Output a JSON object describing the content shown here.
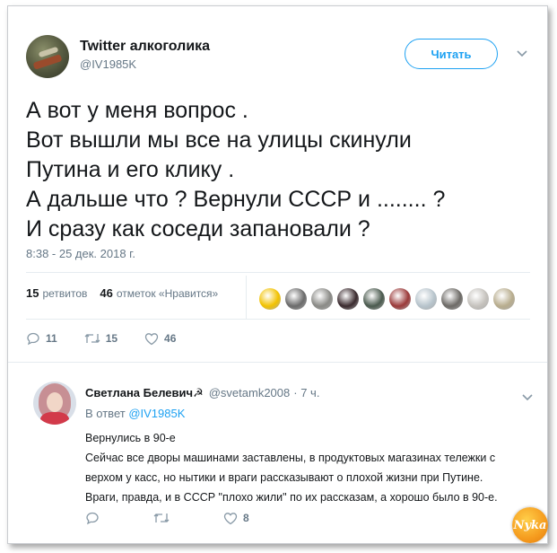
{
  "tweet": {
    "author_name": "Twitter алкоголика",
    "author_handle": "@IV1985K",
    "follow_label": "Читать",
    "text_lines": [
      "А вот у меня вопрос .",
      "Вот вышли мы все на улицы скинули",
      "Путина и его клику .",
      "А дальше что ? Вернули СССР и ........ ?",
      "И сразу как соседи запановали ?"
    ],
    "timestamp": "8:38 - 25 дек. 2018 г.",
    "retweets_count": "15",
    "retweets_label": "ретвитов",
    "likes_count": "46",
    "likes_label": "отметок «Нравится»",
    "actions": {
      "reply_count": "11",
      "retweet_count": "15",
      "like_count": "46"
    }
  },
  "reply": {
    "author_name": "Светлана Белевич☭",
    "author_handle": "@svetamk2008",
    "time": "· 7 ч.",
    "reply_to_prefix": "В ответ",
    "reply_to_handle": "@IV1985K",
    "text_lines": [
      "Вернулись в 90-е",
      "Сейчас все дворы машинами заставлены, в продуктовых магазинах тележки с",
      "верхом у касс, но нытики и враги рассказывают о плохой жизни при Путине.",
      "Враги, правда, и в СССР \"плохо жили\" по их рассказам, а хорошо было в 90-е."
    ],
    "actions": {
      "reply_count": "",
      "retweet_count": "",
      "like_count": "8"
    }
  },
  "watermark_text": "Nyka",
  "colors": {
    "accent": "#1da1f2",
    "text": "#14171a",
    "muted": "#657786",
    "divider": "#e6ecf0"
  },
  "likers": [
    {
      "icon": "liker-avatar-1",
      "color": "#f2c200"
    },
    {
      "icon": "liker-avatar-2",
      "color": "#6b6b6b"
    },
    {
      "icon": "liker-avatar-3",
      "color": "#8a8a86"
    },
    {
      "icon": "liker-avatar-4",
      "color": "#3a2a2e"
    },
    {
      "icon": "liker-avatar-5",
      "color": "#4a5a4e"
    },
    {
      "icon": "liker-avatar-6",
      "color": "#9b3a3a"
    },
    {
      "icon": "liker-avatar-7",
      "color": "#b7c4cc"
    },
    {
      "icon": "liker-avatar-8",
      "color": "#6d6a66"
    },
    {
      "icon": "liker-avatar-9",
      "color": "#c5c2bd"
    },
    {
      "icon": "liker-avatar-10",
      "color": "#b8ad8e"
    }
  ]
}
